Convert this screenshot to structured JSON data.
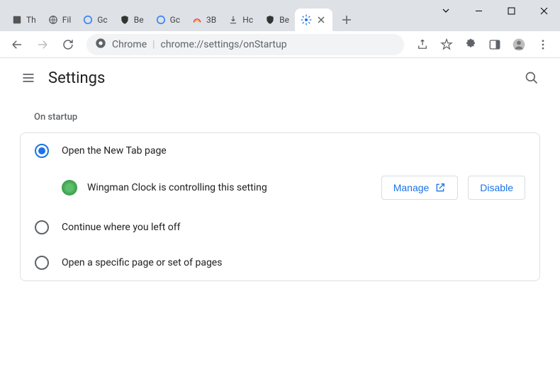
{
  "window": {
    "tabs": [
      {
        "label": "Th"
      },
      {
        "label": "Fil"
      },
      {
        "label": "Gc"
      },
      {
        "label": "Be"
      },
      {
        "label": "Gc"
      },
      {
        "label": "3B"
      },
      {
        "label": "Hc"
      },
      {
        "label": "Be"
      },
      {
        "label": ""
      }
    ]
  },
  "omnibox": {
    "prefix": "Chrome",
    "url_path": "chrome://settings/onStartup"
  },
  "settings": {
    "title": "Settings",
    "section": "On startup",
    "options": [
      {
        "label": "Open the New Tab page",
        "selected": true
      },
      {
        "label": "Continue where you left off",
        "selected": false
      },
      {
        "label": "Open a specific page or set of pages",
        "selected": false
      }
    ],
    "extension": {
      "name": "Wingman Clock is controlling this setting",
      "manage_label": "Manage",
      "disable_label": "Disable"
    }
  }
}
